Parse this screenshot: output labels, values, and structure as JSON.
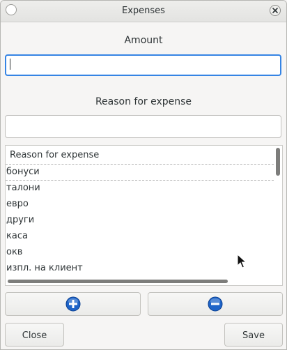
{
  "window": {
    "title": "Expenses"
  },
  "amount": {
    "label": "Amount",
    "value": ""
  },
  "reason": {
    "label": "Reason for expense",
    "value": ""
  },
  "list": {
    "header": "Reason for expense",
    "items": [
      "бонуси",
      "талони",
      "евро",
      "други",
      "каса",
      "окв",
      "изпл. на клиент"
    ],
    "selected_index": 0
  },
  "actions": {
    "add_icon": "plus-circle-icon",
    "remove_icon": "minus-circle-icon"
  },
  "footer": {
    "close_label": "Close",
    "save_label": "Save"
  },
  "colors": {
    "accent": "#3584e4",
    "icon_blue": "#1e64c8"
  }
}
